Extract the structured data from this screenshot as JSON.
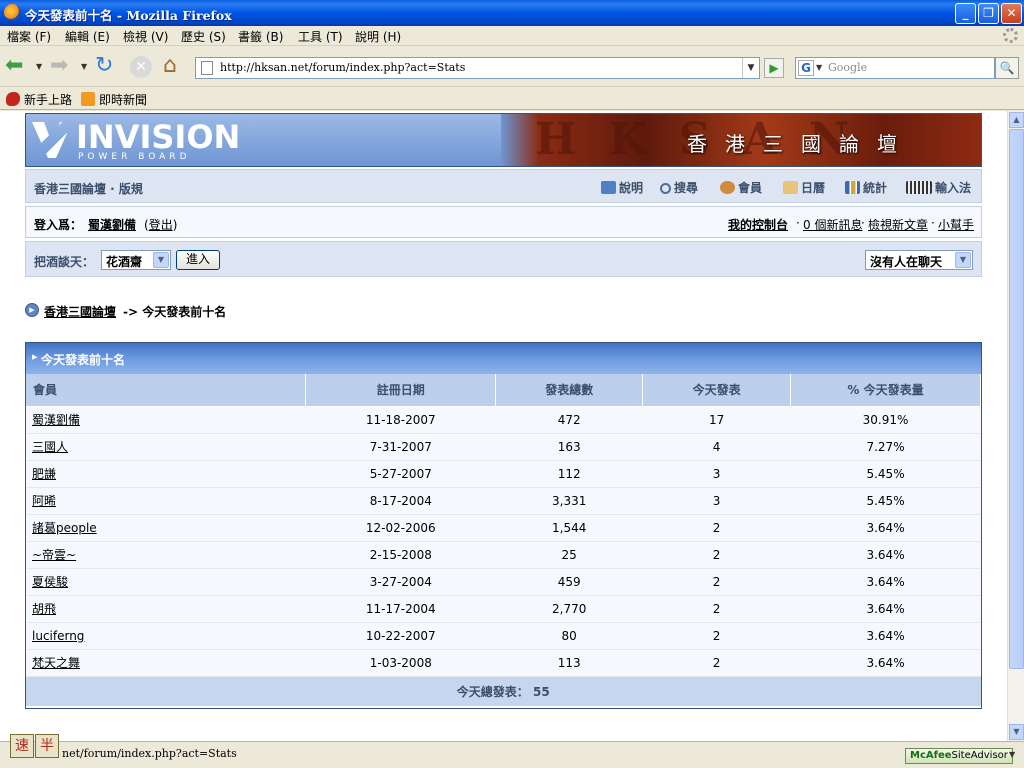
{
  "window": {
    "title": "今天發表前十名 - Mozilla Firefox",
    "minimize": "_",
    "maximize": "❐",
    "close": "✕"
  },
  "menu": [
    "檔案 (F)",
    "編輯 (E)",
    "檢視 (V)",
    "歷史 (S)",
    "書籤 (B)",
    "工具 (T)",
    "說明 (H)"
  ],
  "toolbar": {
    "url": "http://hksan.net/forum/index.php?act=Stats",
    "search_placeholder": "Google",
    "search_engine_icon": "G"
  },
  "bookmarks": [
    "新手上路",
    "即時新聞"
  ],
  "banner": {
    "logo_word": "INVISION",
    "logo_sub": "POWER BOARD",
    "art_bg_text": "HKSAN",
    "art_title": "香港三國論壇"
  },
  "userlinks": {
    "board_title": "香港三國論壇 · 版規",
    "help": "說明",
    "search": "搜尋",
    "members": "會員",
    "calendar": "日曆",
    "stats": "統計",
    "ime": "輸入法"
  },
  "login": {
    "label": "登入爲：",
    "username": "蜀漢劉備",
    "logout_prefix": "(",
    "logout_text": "登出",
    "logout_suffix": ")",
    "control_panel": "我的控制台",
    "messages": "0 個新訊息",
    "new_posts": "檢視新文章",
    "helper": "小幫手",
    "dot": "·"
  },
  "chat": {
    "label": "把酒談天：",
    "room": "花酒齋",
    "enter": "進入",
    "status": "沒有人在聊天"
  },
  "nav": {
    "home": "香港三國論壇",
    "current": "-> 今天發表前十名"
  },
  "stats": {
    "title": "今天發表前十名",
    "headers": [
      "會員",
      "註冊日期",
      "發表總數",
      "今天發表",
      "% 今天發表量"
    ],
    "rows": [
      [
        "蜀漢劉備",
        "11-18-2007",
        "472",
        "17",
        "30.91%"
      ],
      [
        "三國人",
        "7-31-2007",
        "163",
        "4",
        "7.27%"
      ],
      [
        "肥謙",
        "5-27-2007",
        "112",
        "3",
        "5.45%"
      ],
      [
        "阿晞",
        "8-17-2004",
        "3,331",
        "3",
        "5.45%"
      ],
      [
        "諸葛people",
        "12-02-2006",
        "1,544",
        "2",
        "3.64%"
      ],
      [
        "~帝雲~",
        "2-15-2008",
        "25",
        "2",
        "3.64%"
      ],
      [
        "夏侯駿",
        "3-27-2004",
        "459",
        "2",
        "3.64%"
      ],
      [
        "胡飛",
        "11-17-2004",
        "2,770",
        "2",
        "3.64%"
      ],
      [
        "luciferng",
        "10-22-2007",
        "80",
        "2",
        "3.64%"
      ],
      [
        "梵天之舞",
        "1-03-2008",
        "113",
        "2",
        "3.64%"
      ]
    ],
    "total": "今天總發表：  55"
  },
  "statusbar": {
    "text": "net/forum/index.php?act=Stats",
    "ime_speed": "速",
    "ime_half": "半",
    "mcafee_brand": "McAfee",
    "mcafee_product": "SiteAdvisor"
  },
  "colors": {
    "header_bg": "#bcd0ed",
    "row_bg": "#f5f9fd",
    "title_bar": "#0055e5",
    "table_border": "#345487"
  }
}
